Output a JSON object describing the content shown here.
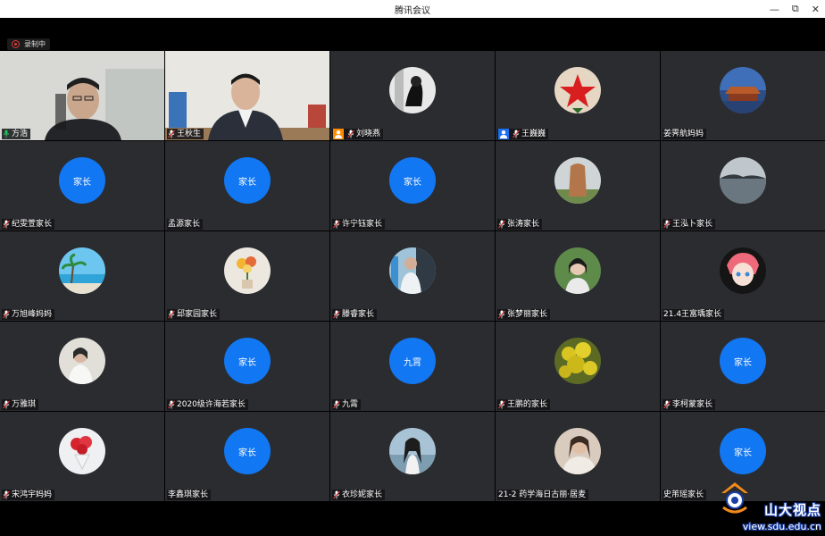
{
  "window": {
    "title": "腾讯会议",
    "minimize": "—",
    "restore": "⧉",
    "close": "✕"
  },
  "recording": {
    "label": "录制中"
  },
  "colors": {
    "avatar_blue": "#1277f2",
    "tile_bg": "#2b2c30",
    "badge_orange": "#ff8a00",
    "badge_blue": "#1d6ff2"
  },
  "participants": [
    {
      "name": "方浩",
      "kind": "video1",
      "mic": "active"
    },
    {
      "name": "王秋生",
      "kind": "video2",
      "mic": "muted"
    },
    {
      "name": "刘晓燕",
      "kind": "photo-bw",
      "mic": "muted",
      "badge": "orange"
    },
    {
      "name": "王巍巍",
      "kind": "photo-red-star",
      "mic": "muted",
      "badge": "blue"
    },
    {
      "name": "姜霁航妈妈",
      "kind": "photo-palace",
      "mic": "none"
    },
    {
      "name": "纪雯萱家长",
      "kind": "text",
      "avatar_text": "家长",
      "mic": "muted"
    },
    {
      "name": "孟源家长",
      "kind": "text",
      "avatar_text": "家长",
      "mic": "none"
    },
    {
      "name": "许宁钰家长",
      "kind": "text",
      "avatar_text": "家长",
      "mic": "muted"
    },
    {
      "name": "张涛家长",
      "kind": "photo-stone",
      "mic": "muted"
    },
    {
      "name": "王泓卜家长",
      "kind": "photo-lake",
      "mic": "muted"
    },
    {
      "name": "万旭峰妈妈",
      "kind": "photo-beach",
      "mic": "muted"
    },
    {
      "name": "邱家园家长",
      "kind": "photo-flowers",
      "mic": "muted"
    },
    {
      "name": "滕睿家长",
      "kind": "photo-person",
      "mic": "muted"
    },
    {
      "name": "张梦丽家长",
      "kind": "photo-girl",
      "mic": "muted"
    },
    {
      "name": "21.4王富瑀家长",
      "kind": "photo-anime",
      "mic": "none"
    },
    {
      "name": "万雅琪",
      "kind": "photo-girl-white",
      "mic": "muted"
    },
    {
      "name": "2020级许海若家长",
      "kind": "text",
      "avatar_text": "家长",
      "mic": "muted"
    },
    {
      "name": "九霄",
      "kind": "text",
      "avatar_text": "九霄",
      "mic": "muted"
    },
    {
      "name": "王鹏的家长",
      "kind": "photo-yellow",
      "mic": "muted"
    },
    {
      "name": "李柯蒙家长",
      "kind": "text",
      "avatar_text": "家长",
      "mic": "muted"
    },
    {
      "name": "宋鸿宇妈妈",
      "kind": "photo-roses",
      "mic": "muted"
    },
    {
      "name": "李鑫琪家长",
      "kind": "text",
      "avatar_text": "家长",
      "mic": "none"
    },
    {
      "name": "衣珍妮家长",
      "kind": "photo-girl-sea",
      "mic": "muted"
    },
    {
      "name": "21-2 药学海日古丽·居麦",
      "kind": "photo-woman",
      "mic": "none"
    },
    {
      "name": "史芾瑶家长",
      "kind": "text",
      "avatar_text": "家长",
      "mic": "none"
    }
  ],
  "watermark": {
    "title": "山大视点",
    "url": "view.sdu.edu.cn"
  }
}
